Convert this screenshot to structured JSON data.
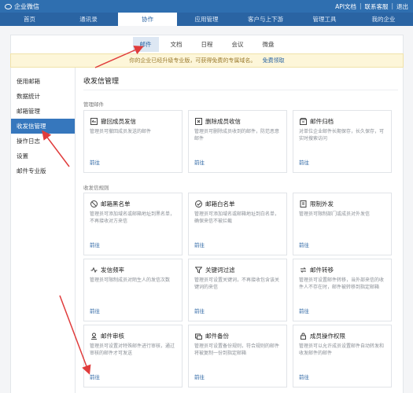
{
  "topbar": {
    "brand": "企业微信",
    "links": [
      "API文档",
      "联系客服",
      "退出"
    ]
  },
  "mainnav": {
    "items": [
      "首页",
      "通讯录",
      "协作",
      "应用管理",
      "客户与上下游",
      "管理工具",
      "我的企业"
    ],
    "active_index": 2
  },
  "subnav": {
    "items": [
      "邮件",
      "文档",
      "日程",
      "会议",
      "微盘"
    ],
    "active_index": 0
  },
  "notice": {
    "text": "你的企业已经升级专业版，可获得免费的专属域名。",
    "link": "免费领取"
  },
  "sidebar": {
    "items": [
      "使用邮箱",
      "数据统计",
      "邮箱管理",
      "收发信管理",
      "操作日志",
      "设置",
      "邮件专业版"
    ],
    "active_index": 3
  },
  "main": {
    "title": "收发信管理",
    "section1": "管理邮件",
    "section2": "收发信规则",
    "cards": [
      {
        "title": "撤回成员发信",
        "desc": "管理员可撤回成员发送的邮件",
        "link": "前往",
        "icon": "recall-icon"
      },
      {
        "title": "删除成员收信",
        "desc": "管理员可删除成员收到的邮件，防范恶意邮件",
        "link": "前往",
        "icon": "delete-mail-icon"
      },
      {
        "title": "邮件归档",
        "desc": "对单位企业邮件长期保存，长久保存，可实时搜索访问",
        "link": "前往",
        "icon": "archive-icon"
      },
      {
        "title": "邮箱黑名单",
        "desc": "管理员可添加域名或邮箱地址到黑名单，不再接收对方来信",
        "link": "前往",
        "icon": "blacklist-icon"
      },
      {
        "title": "邮箱白名单",
        "desc": "管理员可添加域名或邮箱地址到白名单，确保来信不被拦截",
        "link": "前往",
        "icon": "whitelist-icon"
      },
      {
        "title": "限制外发",
        "desc": "管理员可限制部门或成员对外发信",
        "link": "前往",
        "icon": "restrict-send-icon"
      },
      {
        "title": "发信频率",
        "desc": "管理员可限制成员对陌生人的发信次数",
        "link": "前往",
        "icon": "frequency-icon"
      },
      {
        "title": "关键词过滤",
        "desc": "管理员可设置关键词，不再接收包含该关键词的来信",
        "link": "前往",
        "icon": "filter-icon"
      },
      {
        "title": "邮件转移",
        "desc": "管理员可设置邮件转移，当外部来信的收件人不存在时，邮件被转移到指定邮箱",
        "link": "前往",
        "icon": "transfer-icon"
      },
      {
        "title": "邮件审核",
        "desc": "管理员可设置对特殊邮件进行审核，通过审核的邮件才可发送",
        "link": "前往",
        "icon": "audit-icon"
      },
      {
        "title": "邮件备份",
        "desc": "管理员可设置备份规则，符合规则的邮件将被复制一份到指定邮箱",
        "link": "前往",
        "icon": "backup-icon"
      },
      {
        "title": "成员操作权限",
        "desc": "管理员可以允许成员设置邮件自动转发和收发邮件的邮件",
        "link": "前往",
        "icon": "permission-icon"
      }
    ]
  },
  "colors": {
    "brand": "#2f6fb0",
    "accent": "#3677bd",
    "arrow": "#e03c3c"
  }
}
